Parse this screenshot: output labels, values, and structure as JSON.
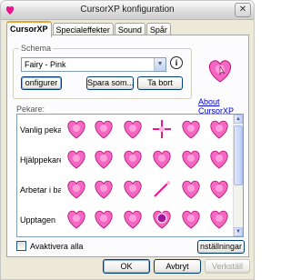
{
  "window": {
    "title": "CursorXP konfiguration",
    "close_glyph": "✕"
  },
  "tabs": [
    "CursorXP",
    "Specialeffekter",
    "Sound",
    "Spår"
  ],
  "schema": {
    "label": "Schema",
    "selected": "Fairy - Pink",
    "buttons": {
      "configure": "onfigurer",
      "save_as": "Spara som...",
      "delete": "Ta bort"
    }
  },
  "about_link": "About CursorXP",
  "pointers": {
    "label": "Pekare:",
    "rows": [
      "Vanlig pekar",
      "Hjälppekare",
      "Arbetar i ba",
      "Upptagen"
    ],
    "deactivate_label": "Avaktivera alla",
    "settings_button": "nställningar"
  },
  "footer": {
    "ok": "OK",
    "cancel": "Avbryt",
    "apply": "Verkställ"
  },
  "colors": {
    "accent_tab": "#e2a63b",
    "cursor_pink": "#e8158f",
    "link": "#0000cc"
  }
}
